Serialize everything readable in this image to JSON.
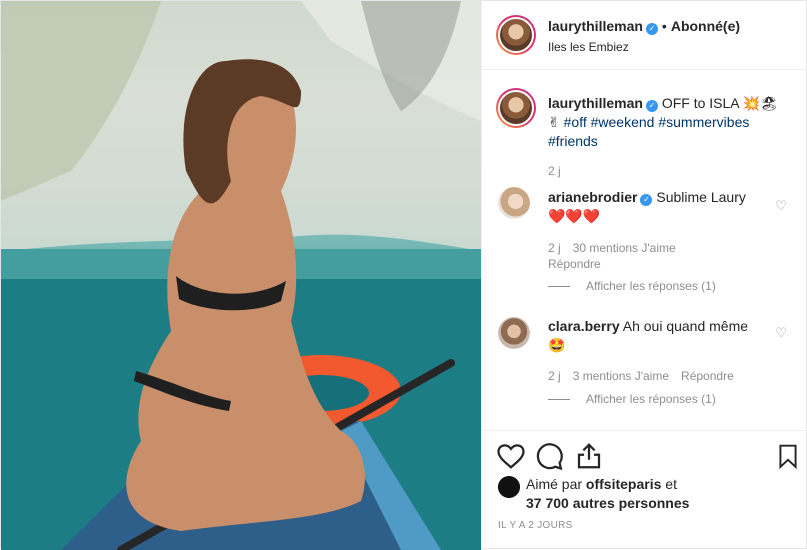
{
  "post": {
    "author": "laurythilleman",
    "follow_label": "Abonné(e)",
    "location": "Iles les Embiez",
    "caption": {
      "text": "OFF to ISLA",
      "emojis": [
        "💥",
        "🏖"
      ],
      "hashtags_line1": "#off #weekend #summervibes",
      "hashtag_line2": "#friends",
      "hand_emoji": "✌",
      "age": "2 j"
    },
    "comments": [
      {
        "user": "arianebrodier",
        "verified": true,
        "text": "Sublime Laury",
        "emojis": "❤️❤️❤️",
        "age": "2 j",
        "likes": "30 mentions J'aime",
        "reply_label": "Répondre",
        "view_replies": "Afficher les réponses (1)"
      },
      {
        "user": "clara.berry",
        "verified": false,
        "text": "Ah oui quand même",
        "emojis": "🤩",
        "age": "2 j",
        "likes": "3 mentions J'aime",
        "reply_label": "Répondre",
        "view_replies": "Afficher les réponses (1)"
      }
    ],
    "liked_by_prefix": "Aimé par",
    "liked_by_user": "offsiteparis",
    "liked_by_suffix": "et",
    "liked_count": "37 700 autres personnes",
    "timestamp": "IL Y A 2 JOURS",
    "icons": [
      "heart-icon",
      "comment-icon",
      "share-icon",
      "bookmark-icon",
      "verified-badge-icon"
    ],
    "colors": {
      "link": "#003569",
      "verified": "#3897f0",
      "muted": "#8e8e8e",
      "text": "#262626"
    }
  }
}
